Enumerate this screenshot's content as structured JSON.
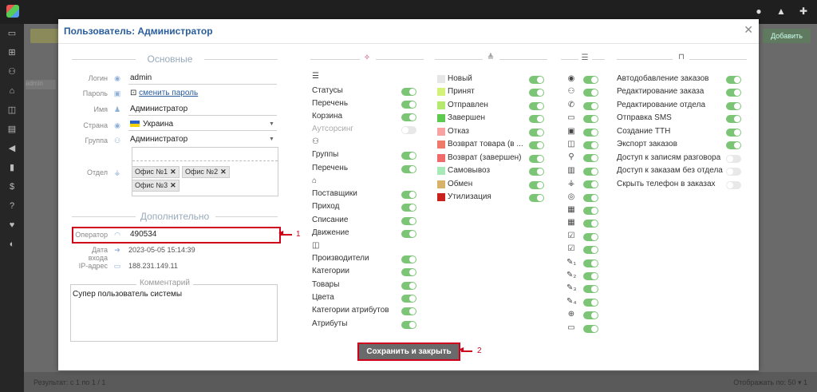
{
  "modal": {
    "title": "Пользователь: Администратор",
    "save_label": "Сохранить и закрыть"
  },
  "background": {
    "add_button": "Добавить",
    "tab_label": "admin",
    "footer_left": "Результат: с 1 по 1 / 1",
    "footer_right": "Отображать по: 50 ▾ 1"
  },
  "basic": {
    "section_title": "Основные",
    "login_label": "Логин",
    "login_value": "admin",
    "password_label": "Пароль",
    "password_link": "сменить пароль",
    "name_label": "Имя",
    "name_value": "Администратор",
    "country_label": "Страна",
    "country_value": "Украина",
    "group_label": "Группа",
    "group_value": "Администратор",
    "dept_label": "Отдел",
    "dept_tags": [
      "Офис №1",
      "Офис №2",
      "Офис №3"
    ]
  },
  "extra": {
    "section_title": "Дополнительно",
    "operator_label": "Оператор",
    "operator_value": "490534",
    "login_date_label": "Дата входа",
    "login_date_value": "2023-05-05 15:14:39",
    "ip_label": "IP-адрес",
    "ip_value": "188.231.149.11",
    "comment_label": "Комментарий",
    "comment_value": "Супер пользователь системы"
  },
  "annotations": [
    "1",
    "2"
  ],
  "access_column": {
    "groups": [
      {
        "icon": "list-icon",
        "items": [
          {
            "label": "Статусы",
            "on": true
          },
          {
            "label": "Перечень",
            "on": true
          },
          {
            "label": "Корзина",
            "on": true
          },
          {
            "label": "Аутсорсинг",
            "on": false
          }
        ]
      },
      {
        "icon": "users-icon",
        "items": [
          {
            "label": "Группы",
            "on": true
          },
          {
            "label": "Перечень",
            "on": true
          }
        ]
      },
      {
        "icon": "warehouse-icon",
        "items": [
          {
            "label": "Поставщики",
            "on": true
          },
          {
            "label": "Приход",
            "on": true
          },
          {
            "label": "Списание",
            "on": true
          },
          {
            "label": "Движение",
            "on": true
          }
        ]
      },
      {
        "icon": "box-icon",
        "items": [
          {
            "label": "Производители",
            "on": true
          },
          {
            "label": "Категории",
            "on": true
          },
          {
            "label": "Товары",
            "on": true
          },
          {
            "label": "Цвета",
            "on": true
          },
          {
            "label": "Категории атрибутов",
            "on": true
          },
          {
            "label": "Атрибуты",
            "on": true
          }
        ]
      }
    ]
  },
  "statuses": [
    {
      "label": "Новый",
      "color": "#e6e6e6",
      "on": true
    },
    {
      "label": "Принят",
      "color": "#d4f27a",
      "on": true
    },
    {
      "label": "Отправлен",
      "color": "#b5e86e",
      "on": true
    },
    {
      "label": "Завершен",
      "color": "#5cc94f",
      "on": true
    },
    {
      "label": "Отказ",
      "color": "#f7a3a3",
      "on": true
    },
    {
      "label": "Возврат товара (в ...",
      "color": "#f07a6a",
      "on": true
    },
    {
      "label": "Возврат (завершен)",
      "color": "#ef6a6a",
      "on": true
    },
    {
      "label": "Самовывоз",
      "color": "#a7eab8",
      "on": true
    },
    {
      "label": "Обмен",
      "color": "#d9b26a",
      "on": true
    },
    {
      "label": "Утилизация",
      "color": "#c9211e",
      "on": true
    }
  ],
  "field_icons": [
    {
      "icon": "globe-icon",
      "glyph": "◉"
    },
    {
      "icon": "users-icon",
      "glyph": "⚇"
    },
    {
      "icon": "phone-icon",
      "glyph": "✆"
    },
    {
      "icon": "comment-icon",
      "glyph": "▭"
    },
    {
      "icon": "money-icon",
      "glyph": "▣"
    },
    {
      "icon": "bag-icon",
      "glyph": "◫"
    },
    {
      "icon": "location-icon",
      "glyph": "⚲"
    },
    {
      "icon": "barcode-icon",
      "glyph": "▥"
    },
    {
      "icon": "sitemap-icon",
      "glyph": "⚶"
    },
    {
      "icon": "user-circle-icon",
      "glyph": "◎"
    },
    {
      "icon": "calendar-icon",
      "glyph": "▦"
    },
    {
      "icon": "calendar-icon",
      "glyph": "▦"
    },
    {
      "icon": "calendar-check-icon",
      "glyph": "☑"
    },
    {
      "icon": "calendar-check-icon",
      "glyph": "☑"
    },
    {
      "icon": "pen-1-icon",
      "glyph": "✎₁"
    },
    {
      "icon": "pen-2-icon",
      "glyph": "✎₂"
    },
    {
      "icon": "pen-3-icon",
      "glyph": "✎₃"
    },
    {
      "icon": "pen-4-icon",
      "glyph": "✎₄"
    },
    {
      "icon": "web-icon",
      "glyph": "⊕"
    },
    {
      "icon": "laptop-icon",
      "glyph": "▭"
    }
  ],
  "permissions": [
    {
      "label": "Автодобавление заказов",
      "on": true
    },
    {
      "label": "Редактирование заказа",
      "on": true
    },
    {
      "label": "Редактирование отдела",
      "on": true
    },
    {
      "label": "Отправка SMS",
      "on": true
    },
    {
      "label": "Создание ТТН",
      "on": true
    },
    {
      "label": "Экспорт заказов",
      "on": true
    },
    {
      "label": "Доступ к записям разговора",
      "on": false
    },
    {
      "label": "Доступ к заказам без отдела",
      "on": false
    },
    {
      "label": "Скрыть телефон в заказах",
      "on": false
    }
  ]
}
